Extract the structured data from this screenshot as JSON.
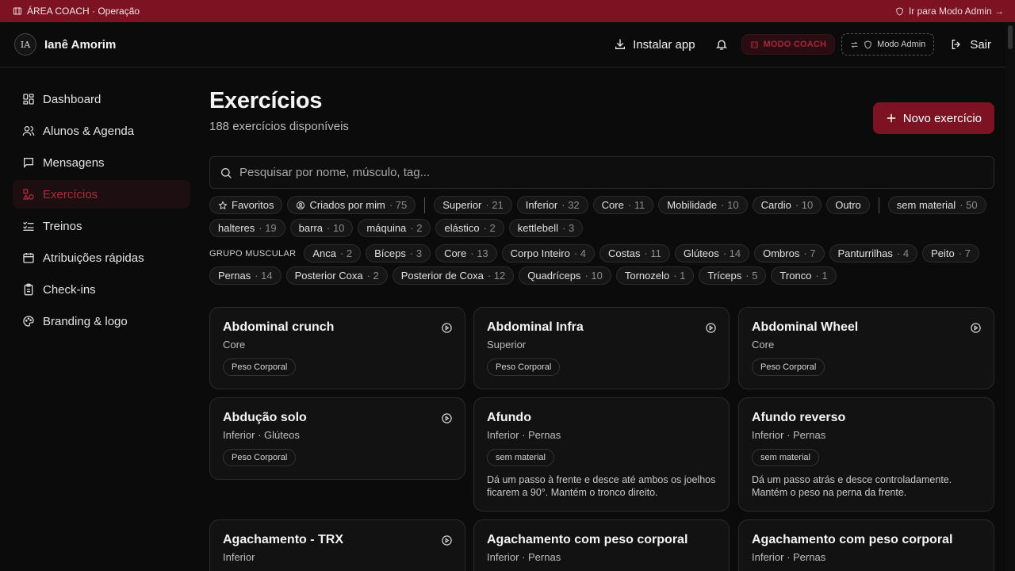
{
  "banner": {
    "left_text": "ÁREA COACH · Operação",
    "right_text": "Ir para Modo Admin →"
  },
  "header": {
    "logo_text": "IA",
    "user_name": "Ianê Amorim",
    "install_label": "Instalar app",
    "coach_mode_label": "MODO COACH",
    "admin_mode_label": "Modo Admin",
    "logout_label": "Sair"
  },
  "sidebar": {
    "items": [
      {
        "label": "Dashboard",
        "icon": "dashboard-icon"
      },
      {
        "label": "Alunos & Agenda",
        "icon": "users-icon"
      },
      {
        "label": "Mensagens",
        "icon": "message-icon"
      },
      {
        "label": "Exercícios",
        "icon": "shapes-icon",
        "active": true
      },
      {
        "label": "Treinos",
        "icon": "list-check-icon"
      },
      {
        "label": "Atribuições rápidas",
        "icon": "calendar-icon"
      },
      {
        "label": "Check-ins",
        "icon": "clipboard-icon"
      },
      {
        "label": "Branding & logo",
        "icon": "palette-icon"
      }
    ]
  },
  "main": {
    "title": "Exercícios",
    "subtitle": "188 exercícios disponíveis",
    "new_button": "Novo exercício",
    "search_placeholder": "Pesquisar por nome, músculo, tag..."
  },
  "filters": {
    "row1": {
      "favorites": {
        "label": "Favoritos"
      },
      "mine": {
        "label": "Criados por mim",
        "count": "· 75"
      },
      "categories": [
        {
          "label": "Superior",
          "count": "· 21"
        },
        {
          "label": "Inferior",
          "count": "· 32"
        },
        {
          "label": "Core",
          "count": "· 11"
        },
        {
          "label": "Mobilidade",
          "count": "· 10"
        },
        {
          "label": "Cardio",
          "count": "· 10"
        },
        {
          "label": "Outro",
          "count": ""
        }
      ],
      "equipment_first": {
        "label": "sem material",
        "count": "· 50"
      }
    },
    "row2": [
      {
        "label": "halteres",
        "count": "· 19"
      },
      {
        "label": "barra",
        "count": "· 10"
      },
      {
        "label": "máquina",
        "count": "· 2"
      },
      {
        "label": "elástico",
        "count": "· 2"
      },
      {
        "label": "kettlebell",
        "count": "· 3"
      }
    ],
    "muscle_group_label": "GRUPO MUSCULAR",
    "row3": [
      {
        "label": "Anca",
        "count": "· 2"
      },
      {
        "label": "Bíceps",
        "count": "· 3"
      },
      {
        "label": "Core",
        "count": "· 13"
      },
      {
        "label": "Corpo Inteiro",
        "count": "· 4"
      },
      {
        "label": "Costas",
        "count": "· 11"
      },
      {
        "label": "Glúteos",
        "count": "· 14"
      },
      {
        "label": "Ombros",
        "count": "· 7"
      },
      {
        "label": "Panturrilhas",
        "count": "· 4"
      },
      {
        "label": "Peito",
        "count": "· 7"
      }
    ],
    "row4": [
      {
        "label": "Pernas",
        "count": "· 14"
      },
      {
        "label": "Posterior Coxa",
        "count": "· 2"
      },
      {
        "label": "Posterior de Coxa",
        "count": "· 12"
      },
      {
        "label": "Quadríceps",
        "count": "· 10"
      },
      {
        "label": "Tornozelo",
        "count": "· 1"
      },
      {
        "label": "Tríceps",
        "count": "· 5"
      },
      {
        "label": "Tronco",
        "count": "· 1"
      }
    ]
  },
  "cards": [
    {
      "title": "Abdominal crunch",
      "subtitle": "Core",
      "tag": "Peso Corporal",
      "desc": "",
      "video": true
    },
    {
      "title": "Abdominal Infra",
      "subtitle": "Superior",
      "tag": "Peso Corporal",
      "desc": "",
      "video": true
    },
    {
      "title": "Abdominal Wheel",
      "subtitle": "Core",
      "tag": "Peso Corporal",
      "desc": "",
      "video": true
    },
    {
      "title": "Abdução solo",
      "subtitle": "Inferior · Glúteos",
      "tag": "Peso Corporal",
      "desc": "",
      "video": true
    },
    {
      "title": "Afundo",
      "subtitle": "Inferior · Pernas",
      "tag": "sem material",
      "desc": "Dá um passo à frente e desce até ambos os joelhos ficarem a 90°. Mantém o tronco direito.",
      "video": false
    },
    {
      "title": "Afundo reverso",
      "subtitle": "Inferior · Pernas",
      "tag": "sem material",
      "desc": "Dá um passo atrás e desce controladamente. Mantém o peso na perna da frente.",
      "video": false
    },
    {
      "title": "Agachamento - TRX",
      "subtitle": "Inferior",
      "tag": "",
      "desc": "",
      "video": true
    },
    {
      "title": "Agachamento com peso corporal",
      "subtitle": "Inferior · Pernas",
      "tag": "",
      "desc": "",
      "video": false
    },
    {
      "title": "Agachamento com peso corporal",
      "subtitle": "Inferior · Pernas",
      "tag": "",
      "desc": "",
      "video": false
    }
  ],
  "colors": {
    "accent": "#7c1222",
    "accent_text": "#b32a3d",
    "background": "#0b0b0b",
    "card": "#121212"
  }
}
